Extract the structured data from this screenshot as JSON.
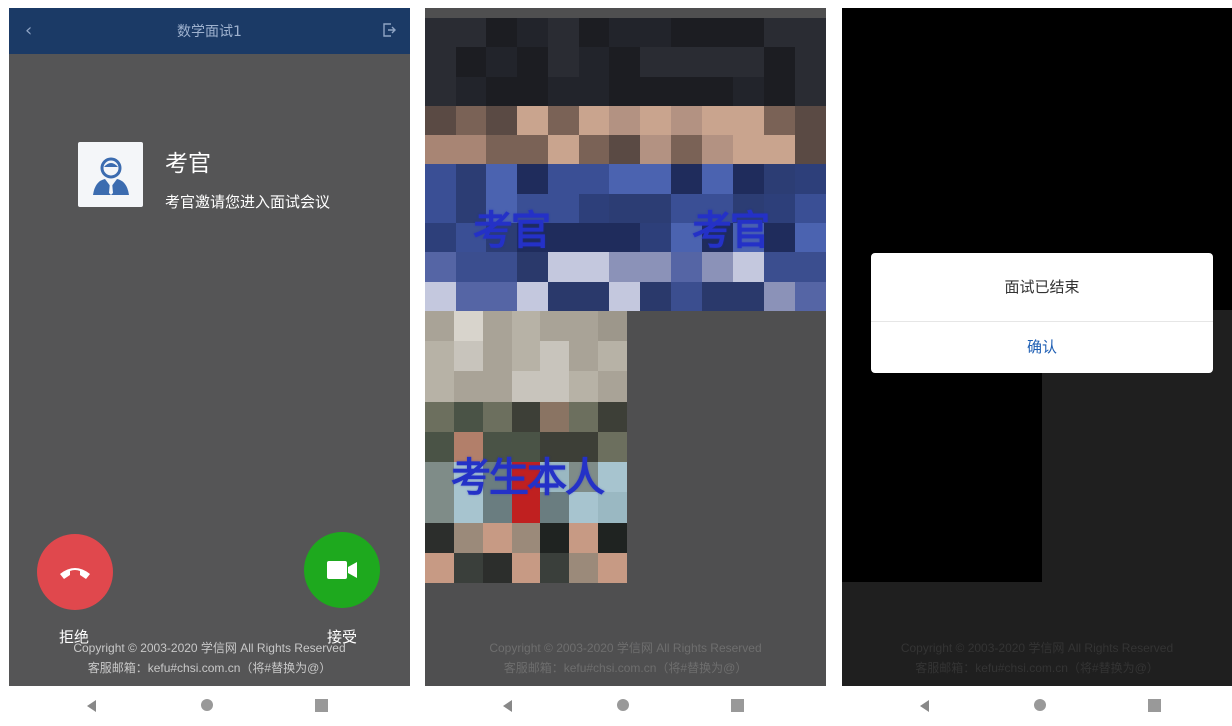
{
  "screen1": {
    "navbar": {
      "title": "数学面试1"
    },
    "caller": {
      "name": "考官",
      "message": "考官邀请您进入面试会议"
    },
    "actions": {
      "reject_label": "拒绝",
      "accept_label": "接受"
    },
    "footer": {
      "copyright": "Copyright © 2003-2020 学信网 All Rights Reserved",
      "email": "客服邮箱：kefu#chsi.com.cn（将#替换为@）"
    }
  },
  "screen2": {
    "tiles": {
      "examiner_1": "考官",
      "examiner_2": "考官",
      "self": "考生本人"
    },
    "footer": {
      "copyright": "Copyright © 2003-2020 学信网 All Rights Reserved",
      "email": "客服邮箱：kefu#chsi.com.cn（将#替换为@）"
    }
  },
  "screen3": {
    "dialog": {
      "message": "面试已结束",
      "confirm_label": "确认"
    },
    "footer": {
      "copyright": "Copyright © 2003-2020 学信网 All Rights Reserved",
      "email": "客服邮箱：kefu#chsi.com.cn（将#替换为@）"
    }
  },
  "icons": {
    "back": "chevron-left-icon",
    "exit": "exit-icon",
    "avatar": "user-avatar-icon",
    "reject": "phone-hangup-icon",
    "accept": "video-camera-icon"
  },
  "colors": {
    "navbar": "#1b3a66",
    "reject": "#e0484d",
    "accept": "#1ea91e",
    "label_blue": "#2431c7",
    "confirm_blue": "#1f5fb4"
  }
}
